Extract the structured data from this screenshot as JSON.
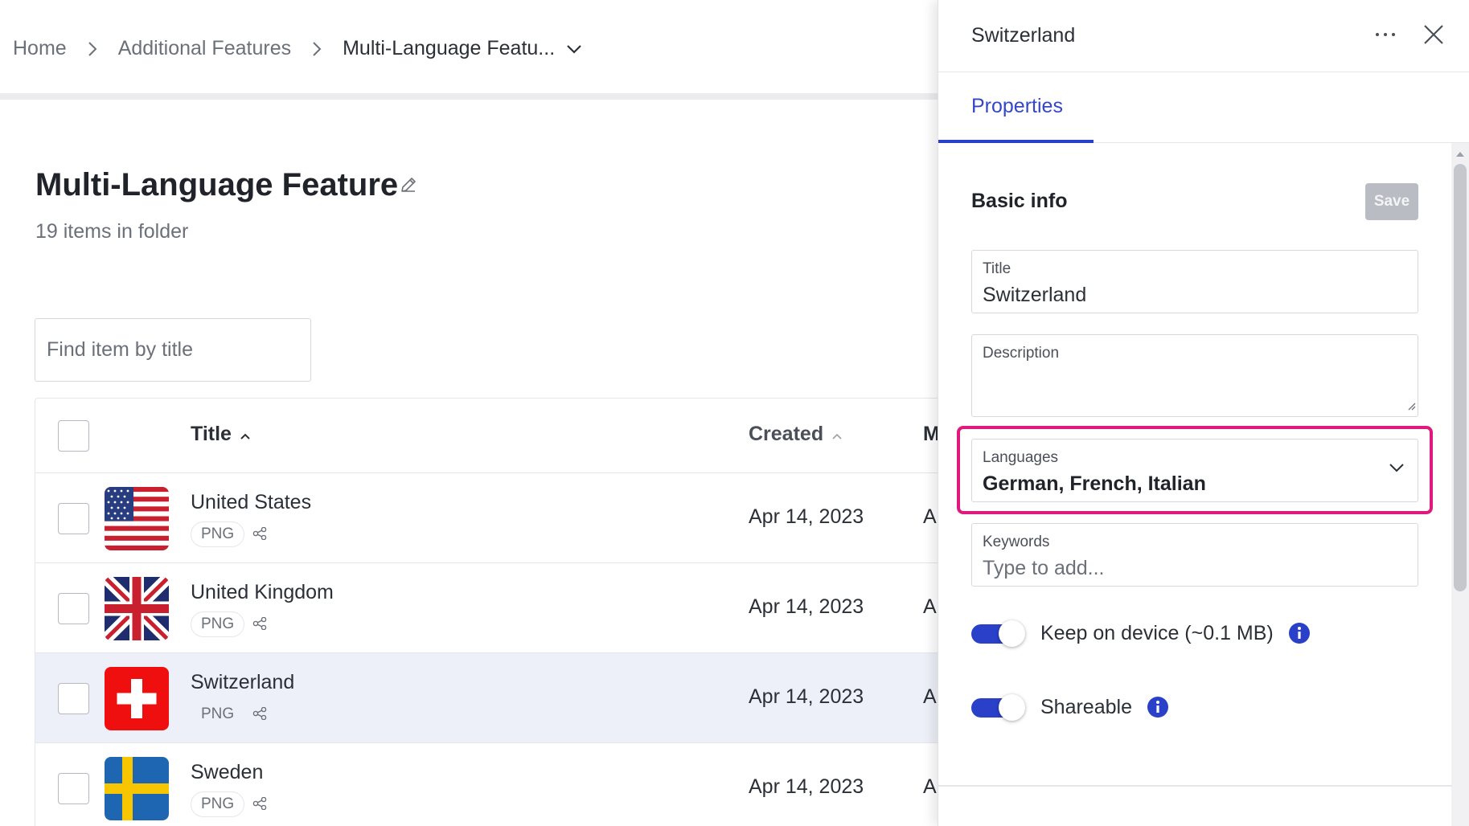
{
  "breadcrumb": {
    "home": "Home",
    "parent": "Additional Features",
    "current": "Multi-Language Featu..."
  },
  "folder": {
    "title": "Multi-Language Feature",
    "subtitle": "19 items in folder"
  },
  "search": {
    "placeholder": "Find item by title"
  },
  "table": {
    "columns": {
      "title": "Title",
      "created": "Created",
      "modified_partial": "M"
    },
    "rows": [
      {
        "title": "United States",
        "type": "PNG",
        "created": "Apr 14, 2023",
        "modified_partial": "A",
        "flag": "us-flag",
        "selected": false
      },
      {
        "title": "United Kingdom",
        "type": "PNG",
        "created": "Apr 14, 2023",
        "modified_partial": "A",
        "flag": "uk-flag",
        "selected": false
      },
      {
        "title": "Switzerland",
        "type": "PNG",
        "created": "Apr 14, 2023",
        "modified_partial": "A",
        "flag": "swiss-flag",
        "selected": true
      },
      {
        "title": "Sweden",
        "type": "PNG",
        "created": "Apr 14, 2023",
        "modified_partial": "A",
        "flag": "sweden-flag",
        "selected": false
      }
    ]
  },
  "panel": {
    "title": "Switzerland",
    "tab": "Properties",
    "section_title": "Basic info",
    "save_label": "Save",
    "fields": {
      "title_label": "Title",
      "title_value": "Switzerland",
      "description_label": "Description",
      "description_value": "",
      "languages_label": "Languages",
      "languages_value": "German, French, Italian",
      "keywords_label": "Keywords",
      "keywords_placeholder": "Type to add..."
    },
    "toggles": {
      "keep_on_device_label": "Keep on device (~0.1 MB)",
      "keep_on_device_on": true,
      "shareable_label": "Shareable",
      "shareable_on": true
    }
  },
  "colors": {
    "accent": "#2a40c8",
    "highlight": "#e0197d",
    "selected_row": "#eef0f9",
    "save_disabled": "#b9bcc3"
  },
  "icons": [
    "chevron-right-icon",
    "chevron-down-icon",
    "pencil-icon",
    "sort-asc-icon",
    "share-icon",
    "more-horizontal-icon",
    "close-icon",
    "info-icon",
    "resize-grip-icon"
  ]
}
